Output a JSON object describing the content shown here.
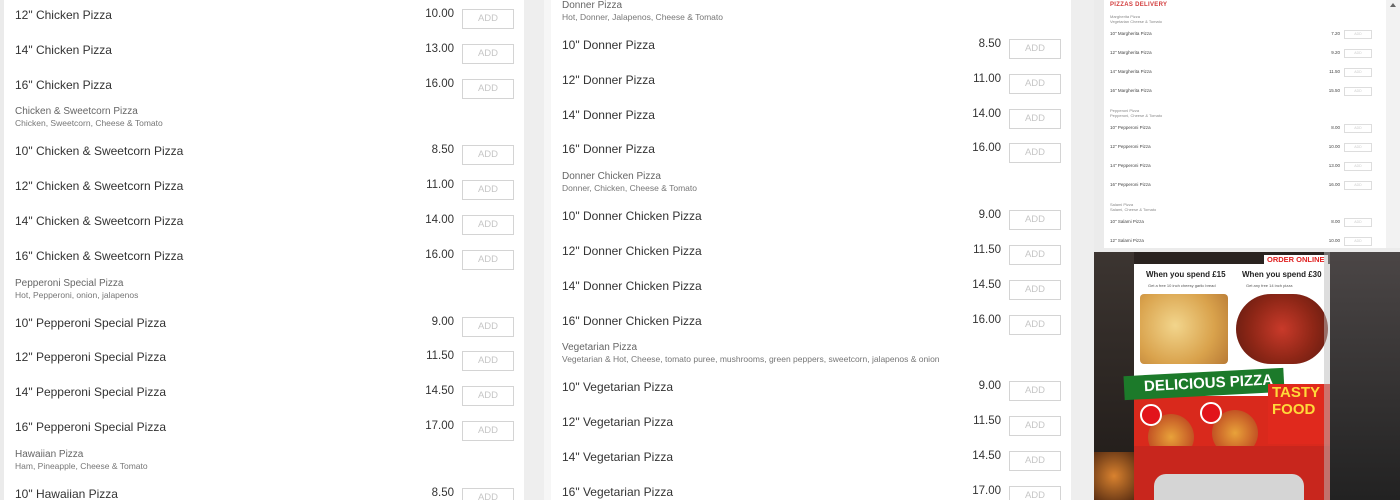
{
  "add_label": "ADD",
  "left_column": [
    {
      "title": "",
      "desc": "",
      "items": [
        {
          "name": "12\" Chicken Pizza",
          "price": "10.00"
        },
        {
          "name": "14\" Chicken Pizza",
          "price": "13.00"
        },
        {
          "name": "16\" Chicken Pizza",
          "price": "16.00"
        }
      ]
    },
    {
      "title": "Chicken & Sweetcorn Pizza",
      "desc": "Chicken, Sweetcorn, Cheese & Tomato",
      "items": [
        {
          "name": "10\" Chicken & Sweetcorn Pizza",
          "price": "8.50"
        },
        {
          "name": "12\" Chicken & Sweetcorn Pizza",
          "price": "11.00"
        },
        {
          "name": "14\" Chicken & Sweetcorn Pizza",
          "price": "14.00"
        },
        {
          "name": "16\" Chicken & Sweetcorn Pizza",
          "price": "16.00"
        }
      ]
    },
    {
      "title": "Pepperoni Special Pizza",
      "desc": "Hot, Pepperoni, onion, jalapenos",
      "items": [
        {
          "name": "10\" Pepperoni Special Pizza",
          "price": "9.00"
        },
        {
          "name": "12\" Pepperoni Special Pizza",
          "price": "11.50"
        },
        {
          "name": "14\" Pepperoni Special Pizza",
          "price": "14.50"
        },
        {
          "name": "16\" Pepperoni Special Pizza",
          "price": "17.00"
        }
      ]
    },
    {
      "title": "Hawaiian Pizza",
      "desc": "Ham, Pineapple, Cheese & Tomato",
      "items": [
        {
          "name": "10\" Hawaiian Pizza",
          "price": "8.50"
        }
      ]
    }
  ],
  "mid_column": [
    {
      "title": "Donner Pizza",
      "desc": "Hot, Donner, Jalapenos, Cheese & Tomato",
      "items": [
        {
          "name": "10\" Donner Pizza",
          "price": "8.50"
        },
        {
          "name": "12\" Donner Pizza",
          "price": "11.00"
        },
        {
          "name": "14\" Donner Pizza",
          "price": "14.00"
        },
        {
          "name": "16\" Donner Pizza",
          "price": "16.00"
        }
      ]
    },
    {
      "title": "Donner Chicken Pizza",
      "desc": "Donner, Chicken, Cheese & Tomato",
      "items": [
        {
          "name": "10\" Donner Chicken Pizza",
          "price": "9.00"
        },
        {
          "name": "12\" Donner Chicken Pizza",
          "price": "11.50"
        },
        {
          "name": "14\" Donner Chicken Pizza",
          "price": "14.50"
        },
        {
          "name": "16\" Donner Chicken Pizza",
          "price": "16.00"
        }
      ]
    },
    {
      "title": "Vegetarian Pizza",
      "desc": "Vegetarian & Hot, Cheese, tomato puree, mushrooms, green peppers, sweetcorn, jalapenos & onion",
      "items": [
        {
          "name": "10\" Vegetarian Pizza",
          "price": "9.00"
        },
        {
          "name": "12\" Vegetarian Pizza",
          "price": "11.50"
        },
        {
          "name": "14\" Vegetarian Pizza",
          "price": "14.50"
        },
        {
          "name": "16\" Vegetarian Pizza",
          "price": "17.00"
        }
      ]
    }
  ],
  "thumbnail": {
    "heading": "PIZZAS DELIVERY",
    "sections": [
      {
        "title": "Margherita Pizza",
        "desc": "Vegetarian Cheese & Tomato",
        "items": [
          {
            "name": "10\" Margherita Pizza",
            "price": "7.20"
          },
          {
            "name": "12\" Margherita Pizza",
            "price": "9.20"
          },
          {
            "name": "14\" Margherita Pizza",
            "price": "11.50"
          },
          {
            "name": "16\" Margherita Pizza",
            "price": "15.50"
          }
        ]
      },
      {
        "title": "Pepperoni Pizza",
        "desc": "Pepperoni, Cheese & Tomato",
        "items": [
          {
            "name": "10\" Pepperoni Pizza",
            "price": "8.00"
          },
          {
            "name": "12\" Pepperoni Pizza",
            "price": "10.00"
          },
          {
            "name": "14\" Pepperoni Pizza",
            "price": "13.00"
          },
          {
            "name": "16\" Pepperoni Pizza",
            "price": "16.00"
          }
        ]
      },
      {
        "title": "Salami Pizza",
        "desc": "Salami, Cheese & Tomato",
        "items": [
          {
            "name": "10\" Salami Pizza",
            "price": "8.00"
          },
          {
            "name": "12\" Salami Pizza",
            "price": "10.00"
          }
        ]
      }
    ]
  },
  "photo": {
    "order_online": "ORDER ONLINE",
    "offer1_title": "When you spend £15",
    "offer1_sub": "Get a free 10 inch cheesy garlic bread",
    "offer2_title": "When you spend £30",
    "offer2_sub": "Get any free 14 inch pizza",
    "banner": "DELICIOUS PIZZA",
    "tasty1": "TASTY",
    "tasty2": "FOOD"
  }
}
